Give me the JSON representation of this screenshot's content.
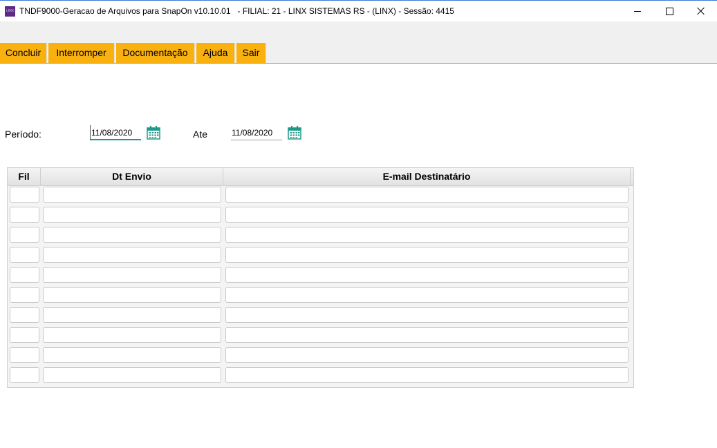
{
  "window": {
    "title": "TNDF9000-Geracao de Arquivos para SnapOn v10.10.01   - FILIAL: 21 - LINX SISTEMAS RS - (LINX) - Sessão: 4415",
    "app_icon_text": "LINX"
  },
  "toolbar": {
    "concluir": "Concluir",
    "interromper": "Interromper",
    "documentacao": "Documentação",
    "ajuda": "Ajuda",
    "sair": "Sair"
  },
  "filter": {
    "periodo_label": "Período:",
    "date_from": "11/08/2020",
    "ate_label": "Ate",
    "date_to": "11/08/2020"
  },
  "grid": {
    "columns": [
      "Fil",
      "Dt Envio",
      "E-mail Destinatário"
    ],
    "rows": [
      {
        "fil": "",
        "dt_envio": "",
        "email": ""
      },
      {
        "fil": "",
        "dt_envio": "",
        "email": ""
      },
      {
        "fil": "",
        "dt_envio": "",
        "email": ""
      },
      {
        "fil": "",
        "dt_envio": "",
        "email": ""
      },
      {
        "fil": "",
        "dt_envio": "",
        "email": ""
      },
      {
        "fil": "",
        "dt_envio": "",
        "email": ""
      },
      {
        "fil": "",
        "dt_envio": "",
        "email": ""
      },
      {
        "fil": "",
        "dt_envio": "",
        "email": ""
      },
      {
        "fil": "",
        "dt_envio": "",
        "email": ""
      },
      {
        "fil": "",
        "dt_envio": "",
        "email": ""
      }
    ]
  },
  "colors": {
    "toolbar_button": "#f9b10f",
    "calendar_icon": "#1f9a8a",
    "app_icon": "#5b2a86"
  }
}
